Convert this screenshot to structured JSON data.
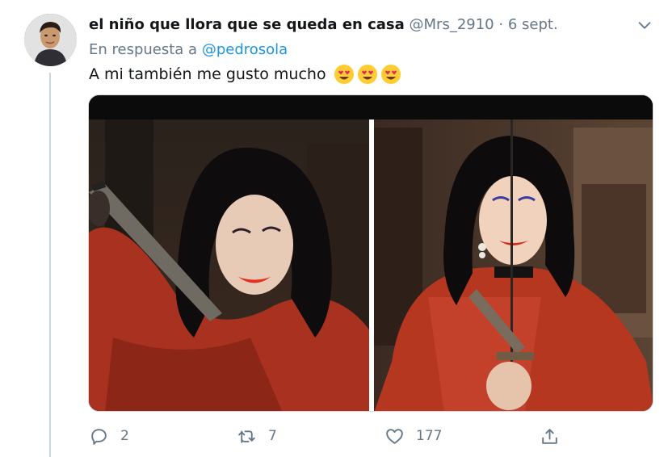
{
  "tweet": {
    "display_name": "el niño que llora que se queda en casa",
    "handle": "@Mrs_2910",
    "separator": "·",
    "date": "6 sept.",
    "reply_prefix": "En respuesta a",
    "reply_mention": "@pedrosola",
    "text": "A mi también me gusto mucho",
    "emojis": [
      "smiling-face-with-heart-eyes",
      "smiling-face-with-heart-eyes",
      "smiling-face-with-heart-eyes"
    ]
  },
  "actions": {
    "reply_count": "2",
    "retweet_count": "7",
    "like_count": "177"
  },
  "colors": {
    "secondary_text": "#657786",
    "link": "#1b95e0",
    "thread_line": "#ccd6dd"
  }
}
